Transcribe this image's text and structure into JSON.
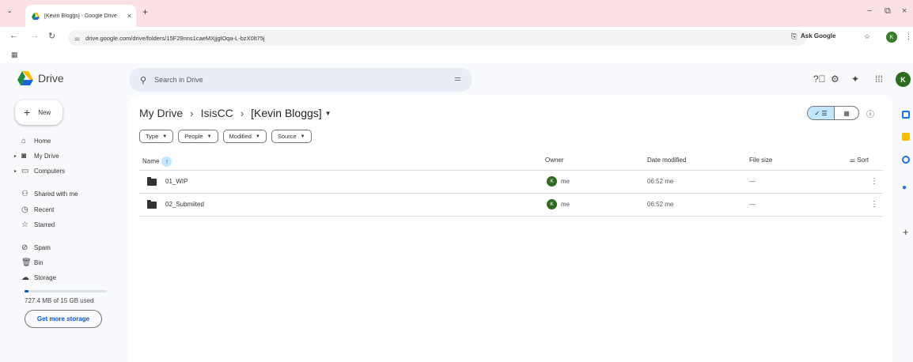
{
  "browser": {
    "tab_title": "[Kevin Bloggs] - Google Drive",
    "tab_close": "×",
    "new_tab": "+",
    "tab_list": "⌄",
    "url": "drive.google.com/drive/folders/15F29nns1caeMXjjglOqa-L-bzX0lt75j",
    "ask_google": "Ask Google",
    "profile_initial": "K",
    "controls": {
      "minimize": "−",
      "restore": "⧉",
      "close": "×"
    }
  },
  "drive": {
    "logo_text": "Drive",
    "search_placeholder": "Search in Drive",
    "avatar_initial": "K"
  },
  "nav": {
    "new_label": "New",
    "items": [
      {
        "label": "Home",
        "icon": "⌂",
        "caret": ""
      },
      {
        "label": "My Drive",
        "icon": "◙",
        "caret": "▸"
      },
      {
        "label": "Computers",
        "icon": "▭",
        "caret": "▸"
      },
      {
        "label": "Shared with me",
        "icon": "⚇",
        "caret": ""
      },
      {
        "label": "Recent",
        "icon": "◷",
        "caret": ""
      },
      {
        "label": "Starred",
        "icon": "☆",
        "caret": ""
      },
      {
        "label": "Spam",
        "icon": "⊘",
        "caret": ""
      },
      {
        "label": "Bin",
        "icon": "🗑",
        "caret": ""
      },
      {
        "label": "Storage",
        "icon": "☁",
        "caret": ""
      }
    ],
    "storage_text": "727.4 MB of 15 GB used",
    "storage_fraction": 0.047,
    "get_storage_label": "Get more storage"
  },
  "main": {
    "breadcrumb": [
      "My Drive",
      "IsisCC",
      "[Kevin Bloggs]"
    ],
    "filters": [
      "Type",
      "People",
      "Modified",
      "Source"
    ],
    "columns": {
      "name": "Name",
      "owner": "Owner",
      "date": "Date modified",
      "size": "File size",
      "sort": "Sort"
    },
    "rows": [
      {
        "name": "01_WIP",
        "owner": "me",
        "owner_initial": "K",
        "date": "06:52 me",
        "size": "—"
      },
      {
        "name": "02_Submiited",
        "owner": "me",
        "owner_initial": "K",
        "date": "06:52 me",
        "size": "—"
      }
    ]
  },
  "colors": {
    "accent": "#0b57d0",
    "tabstrip": "#fbe0e5",
    "avatar": "#2e6b1f",
    "selected": "#c2e7ff"
  }
}
